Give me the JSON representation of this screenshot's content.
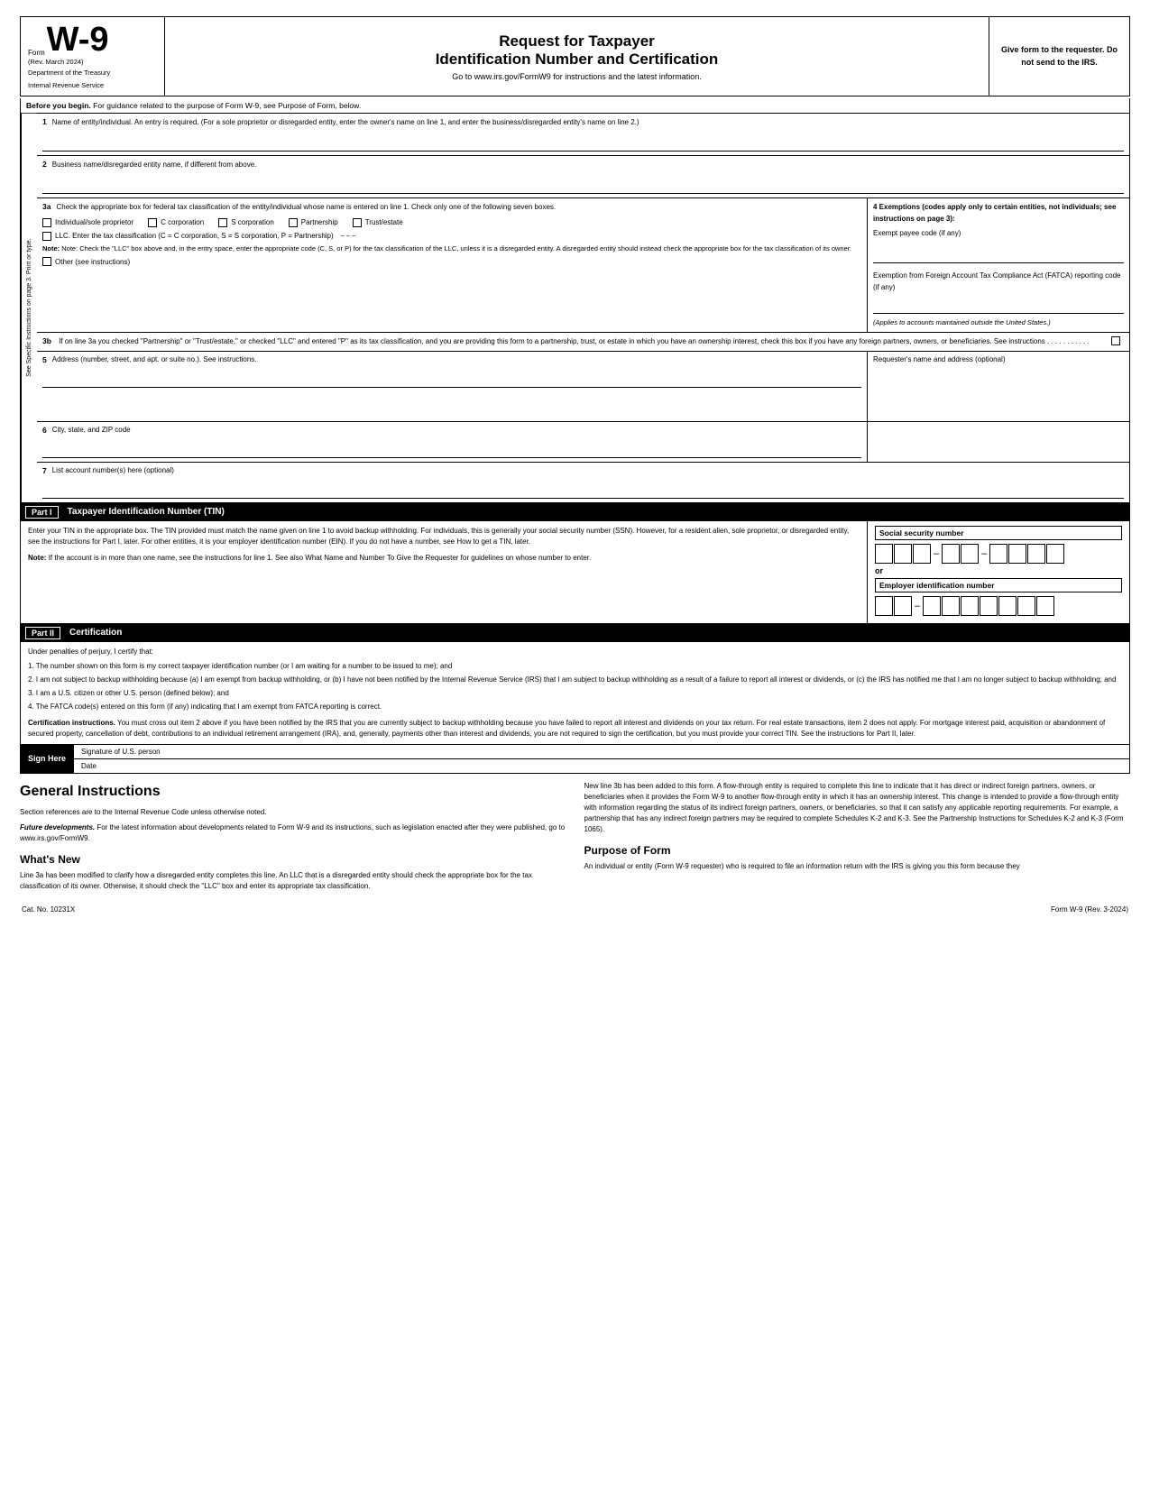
{
  "form": {
    "form_label": "Form",
    "form_number": "W-9",
    "rev_date": "(Rev. March 2024)",
    "dept": "Department of the Treasury",
    "irs": "Internal Revenue Service",
    "title1": "Request for Taxpayer",
    "title2": "Identification Number and Certification",
    "go_to": "Go to www.irs.gov/FormW9 for instructions and the latest information.",
    "give_form": "Give form to the requester. Do not send to the IRS.",
    "before_begin_label": "Before you begin.",
    "before_begin_text": "For guidance related to the purpose of Form W-9, see Purpose of Form, below.",
    "line1_num": "1",
    "line1_label": "Name of entity/individual. An entry is required. (For a sole proprietor or disregarded entity, enter the owner's name on line 1, and enter the business/disregarded entity's name on line 2.)",
    "line2_num": "2",
    "line2_label": "Business name/disregarded entity name, if different from above.",
    "line3a_num": "3a",
    "line3a_label": "Check the appropriate box for federal tax classification of the entity/individual whose name is entered on line 1. Check only one of the following seven boxes.",
    "cb1_label": "Individual/sole proprietor",
    "cb2_label": "C corporation",
    "cb3_label": "S corporation",
    "cb4_label": "Partnership",
    "cb5_label": "Trust/estate",
    "cb6_label": "LLC. Enter the tax classification (C = C corporation, S = S corporation, P = Partnership)",
    "note_3a": "Note: Check the \"LLC\" box above and, in the entry space, enter the appropriate code (C, S, or P) for the tax classification of the LLC, unless it is a disregarded entity. A disregarded entity should instead check the appropriate box for the tax classification of its owner.",
    "cb7_label": "Other (see instructions)",
    "exemptions_header": "4 Exemptions (codes apply only to certain entities, not individuals; see instructions on page 3):",
    "exempt_payee": "Exempt payee code (if any)",
    "fatca_label": "Exemption from Foreign Account Tax Compliance Act (FATCA) reporting code (if any)",
    "fatca_note": "(Applies to accounts maintained outside the United States.)",
    "line3b_num": "3b",
    "line3b_text": "If on line 3a you checked \"Partnership\" or \"Trust/estate,\" or checked \"LLC\" and entered \"P\" as its tax classification, and you are providing this form to a partnership, trust, or estate in which you have an ownership interest, check this box if you have any foreign partners, owners, or beneficiaries. See instructions . . . . . . . . . . .",
    "line5_num": "5",
    "line5_label": "Address (number, street, and apt. or suite no.). See instructions.",
    "line5_right": "Requester's name and address (optional)",
    "line6_num": "6",
    "line6_label": "City, state, and ZIP code",
    "line7_num": "7",
    "line7_label": "List account number(s) here (optional)",
    "side_label": "See Specific Instructions on page 3. Print or type.",
    "part1_label": "Part I",
    "part1_title": "Taxpayer Identification Number (TIN)",
    "part1_intro": "Enter your TIN in the appropriate box. The TIN provided must match the name given on line 1 to avoid backup withholding. For individuals, this is generally your social security number (SSN). However, for a resident alien, sole proprietor, or disregarded entity, see the instructions for Part I, later. For other entities, it is your employer identification number (EIN). If you do not have a number, see How to get a TIN, later.",
    "part1_note_label": "Note:",
    "part1_note_text": "If the account is in more than one name, see the instructions for line 1. See also What Name and Number To Give the Requester for guidelines on whose number to enter.",
    "ssn_label": "Social security number",
    "ein_label": "Employer identification number",
    "or_text": "or",
    "part2_label": "Part II",
    "part2_title": "Certification",
    "cert_intro": "Under penalties of perjury, I certify that:",
    "cert_items": [
      "1. The number shown on this form is my correct taxpayer identification number (or I am waiting for a number to be issued to me); and",
      "2. I am not subject to backup withholding because (a) I am exempt from backup withholding, or (b) I have not been notified by the Internal Revenue Service (IRS) that I am subject to backup withholding as a result of a failure to report all interest or dividends, or (c) the IRS has notified me that I am no longer subject to backup withholding; and",
      "3. I am a U.S. citizen or other U.S. person (defined below); and",
      "4. The FATCA code(s) entered on this form (if any) indicating that I am exempt from FATCA reporting is correct."
    ],
    "cert_instructions_label": "Certification instructions.",
    "cert_instructions_text": "You must cross out item 2 above if you have been notified by the IRS that you are currently subject to backup withholding because you have failed to report all interest and dividends on your tax return. For real estate transactions, item 2 does not apply. For mortgage interest paid, acquisition or abandonment of secured property, cancellation of debt, contributions to an individual retirement arrangement (IRA), and, generally, payments other than interest and dividends, you are not required to sign the certification, but you must provide your correct TIN. See the instructions for Part II, later.",
    "sign_here": "Sign Here",
    "signature_label": "Signature of U.S. person",
    "date_label": "Date",
    "gi_title": "General Instructions",
    "gi_para1": "Section references are to the Internal Revenue Code unless otherwise noted.",
    "gi_future_label": "Future developments.",
    "gi_future_text": "For the latest information about developments related to Form W-9 and its instructions, such as legislation enacted after they were published, go to www.irs.gov/FormW9.",
    "gi_whats_new_title": "What's New",
    "gi_whats_new_text": "Line 3a has been modified to clarify how a disregarded entity completes this line. An LLC that is a disregarded entity should check the appropriate box for the tax classification of its owner. Otherwise, it should check the \"LLC\" box and enter its appropriate tax classification.",
    "gi_right_para": "New line 3b has been added to this form. A flow-through entity is required to complete this line to indicate that it has direct or indirect foreign partners, owners, or beneficiaries when it provides the Form W-9 to another flow-through entity in which it has an ownership interest. This change is intended to provide a flow-through entity with information regarding the status of its indirect foreign partners, owners, or beneficiaries, so that it can satisfy any applicable reporting requirements. For example, a partnership that has any indirect foreign partners may be required to complete Schedules K-2 and K-3. See the Partnership Instructions for Schedules K-2 and K-3 (Form 1065).",
    "gi_purpose_title": "Purpose of Form",
    "gi_purpose_text": "An individual or entity (Form W-9 requester) who is required to file an information return with the IRS is giving you this form because they",
    "cat_no": "Cat. No. 10231X",
    "form_bottom": "Form W-9 (Rev. 3-2024)"
  }
}
